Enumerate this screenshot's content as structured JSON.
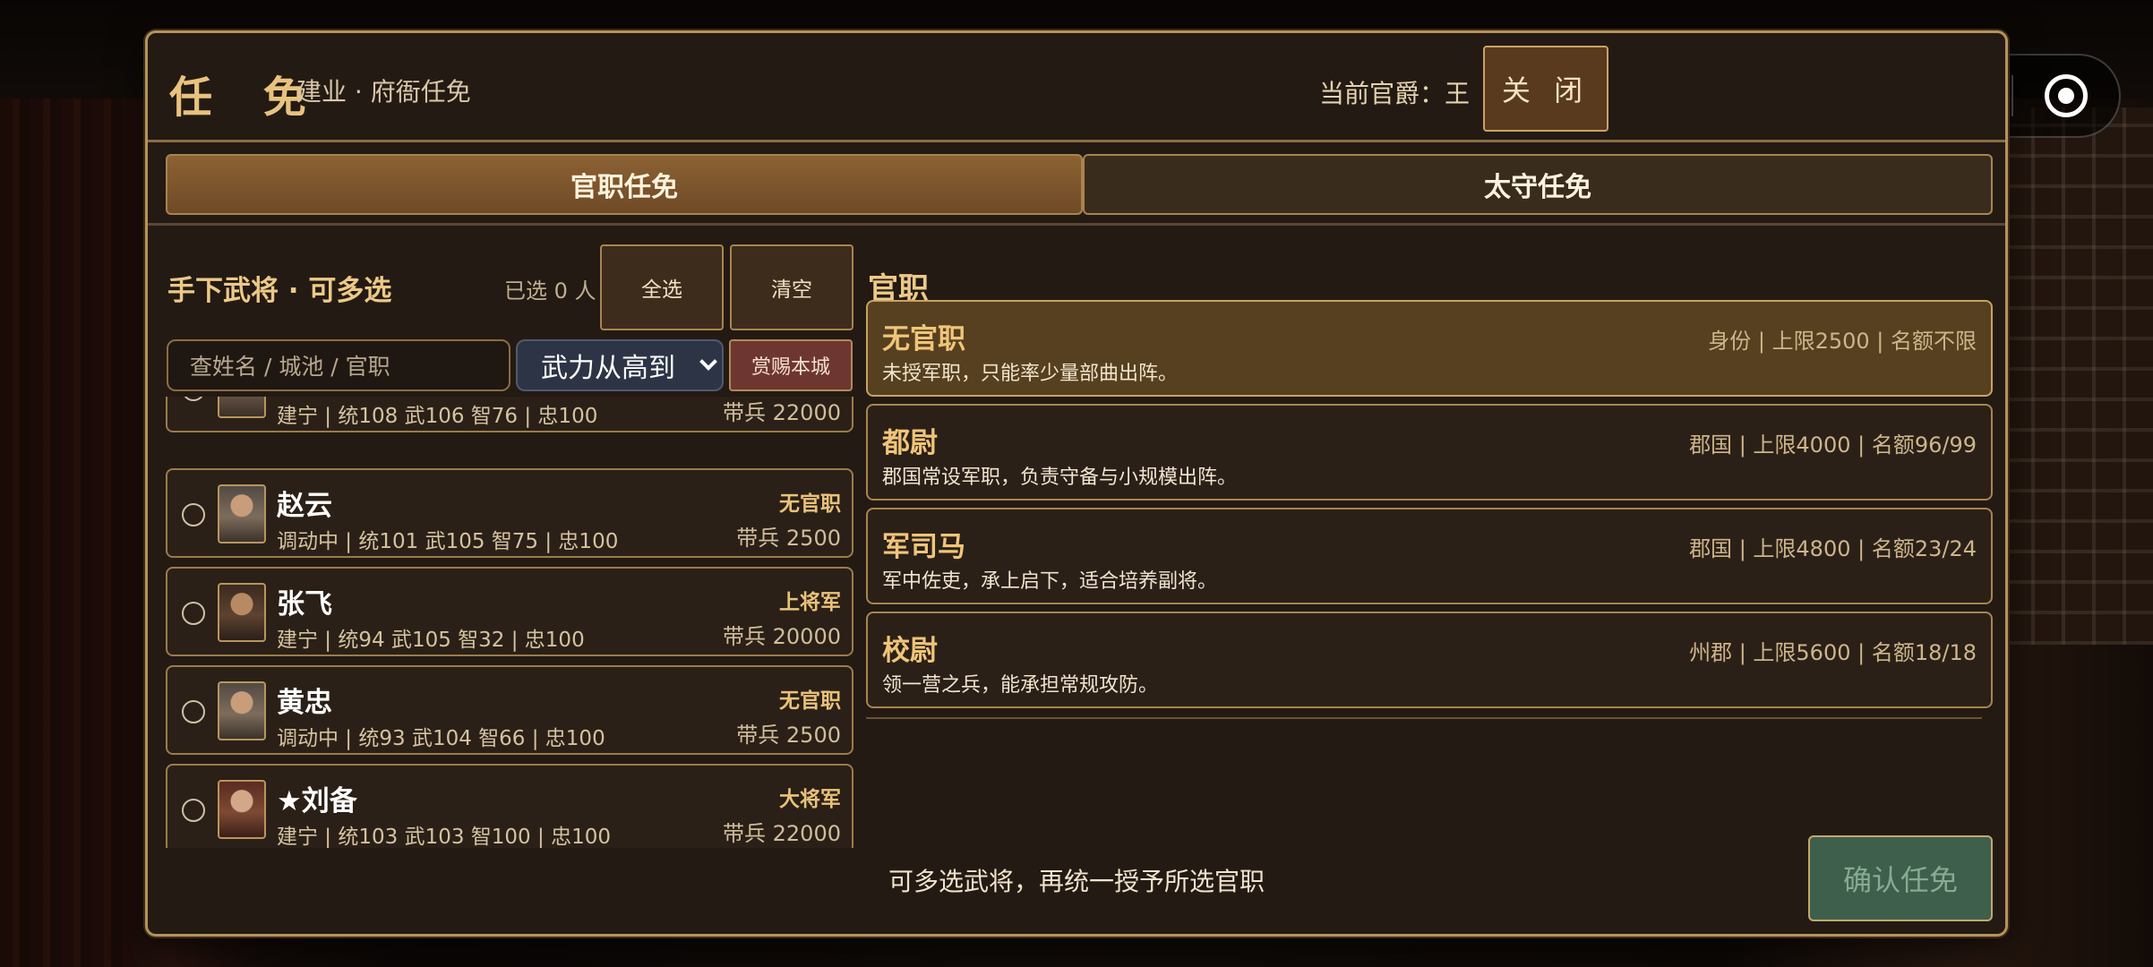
{
  "header": {
    "title": "任 免",
    "subtitle": "建业 · 府衙任免",
    "current_rank": "当前官爵：王",
    "close_label": "关 闭"
  },
  "tabs": [
    {
      "label": "官职任免",
      "active": true
    },
    {
      "label": "太守任免",
      "active": false
    }
  ],
  "left": {
    "title": "手下武将 · 可多选",
    "selected_count": "已选 0 人",
    "select_all": "全选",
    "clear": "清空",
    "search_placeholder": "查姓名 / 城池 / 官职",
    "sort_value": "武力从高到",
    "reward_button": "赏赐本城",
    "generals": [
      {
        "name": "",
        "stats": "建宁 | 统108 武106 智76 | 忠100",
        "rank": "",
        "troops": "带兵 22000"
      },
      {
        "name": "赵云",
        "stats": "调动中 | 统101 武105 智75 | 忠100",
        "rank": "无官职",
        "troops": "带兵 2500"
      },
      {
        "name": "张飞",
        "stats": "建宁 | 统94 武105 智32 | 忠100",
        "rank": "上将军",
        "troops": "带兵 20000"
      },
      {
        "name": "黄忠",
        "stats": "调动中 | 统93 武104 智66 | 忠100",
        "rank": "无官职",
        "troops": "带兵 2500"
      },
      {
        "name": "★刘备",
        "stats": "建宁 | 统103 武103 智100 | 忠100",
        "rank": "大将军",
        "troops": "带兵 22000"
      }
    ]
  },
  "right": {
    "title": "官职",
    "offices": [
      {
        "name": "无官职",
        "info": "身份 | 上限2500 | 名额不限",
        "desc": "未授军职，只能率少量部曲出阵。",
        "selected": true
      },
      {
        "name": "都尉",
        "info": "郡国 | 上限4000 | 名额96/99",
        "desc": "郡国常设军职，负责守备与小规模出阵。",
        "selected": false
      },
      {
        "name": "军司马",
        "info": "郡国 | 上限4800 | 名额23/24",
        "desc": "军中佐吏，承上启下，适合培养副将。",
        "selected": false
      },
      {
        "name": "校尉",
        "info": "州郡 | 上限5600 | 名额18/18",
        "desc": "领一营之兵，能承担常规攻防。",
        "selected": false
      }
    ]
  },
  "footer": {
    "hint": "可多选武将，再统一授予所选官职",
    "confirm": "确认任免"
  },
  "colors": {
    "accent_gold": "#e8c27e",
    "panel_bg": "#231a13",
    "active_tab": "#8c6234",
    "confirm_bg": "#3e5f4c"
  }
}
